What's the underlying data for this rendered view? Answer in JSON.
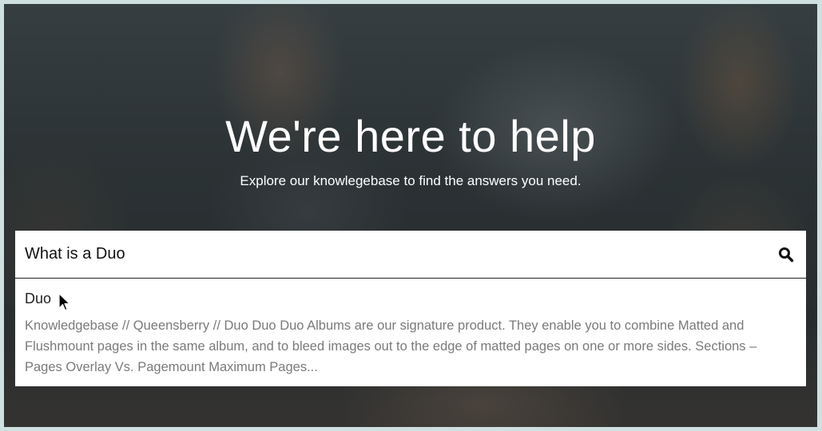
{
  "hero": {
    "title": "We're here to help",
    "subtitle": "Explore our knowlegebase to find the answers you need."
  },
  "search": {
    "value": "What is a Duo",
    "icon": "search-icon"
  },
  "results": [
    {
      "title": "Duo",
      "snippet": "Knowledgebase // Queensberry // Duo Duo Duo Albums are our signature product. They enable you to combine Matted and Flushmount pages in the same album, and to bleed images out to the edge of matted pages on one or more sides.  Sections – Pages Overlay Vs. Pagemount Maximum Pages..."
    }
  ],
  "colors": {
    "frame": "#cfe0e0",
    "text_white": "#ffffff",
    "snippet_gray": "#7a7a7a"
  }
}
